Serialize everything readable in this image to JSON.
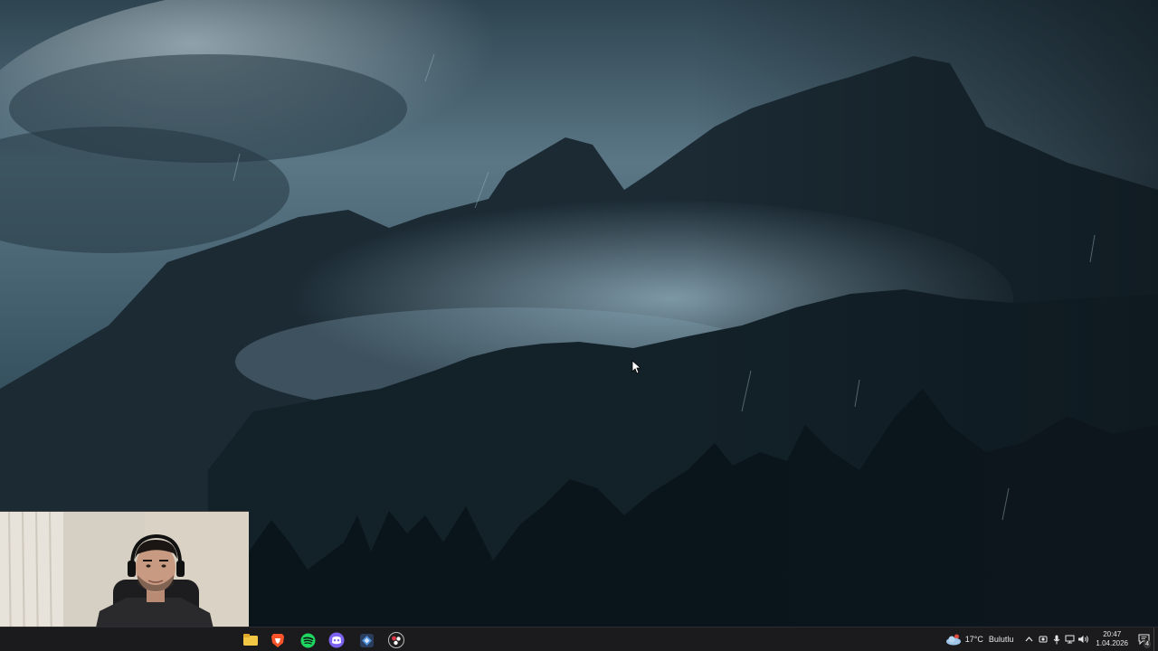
{
  "wallpaper": {
    "subject": "stormy misty mountains with pine forest",
    "colors": {
      "sky": "#5b7786",
      "mist": "#8fb0c0",
      "mountain": "#1b2a33",
      "forest": "#0d1a21"
    }
  },
  "webcam": {
    "subject": "streamer webcam overlay",
    "colors": {
      "wall": "#d6cfc4",
      "curtain": "#e7e2da",
      "shirt": "#2a2a2c",
      "skin": "#c89a82",
      "hair": "#1b1614"
    }
  },
  "taskbar": {
    "background": "#1b1b1d",
    "pinned_apps": [
      {
        "name": "file-explorer-icon",
        "color": "#f2c744"
      },
      {
        "name": "brave-browser-icon",
        "color": "#fb542b"
      },
      {
        "name": "spotify-icon",
        "color": "#1ed760"
      },
      {
        "name": "discord-icon",
        "color": "#7c62f0"
      },
      {
        "name": "app-diamond-icon",
        "color": "#4f8fd8"
      },
      {
        "name": "obs-studio-icon",
        "color": "#e0364a"
      }
    ]
  },
  "tray": {
    "weather_temp": "17°C",
    "weather_desc": "Bulutlu",
    "time": "20:47",
    "date": "1.04.2026",
    "notification_count": "4"
  }
}
